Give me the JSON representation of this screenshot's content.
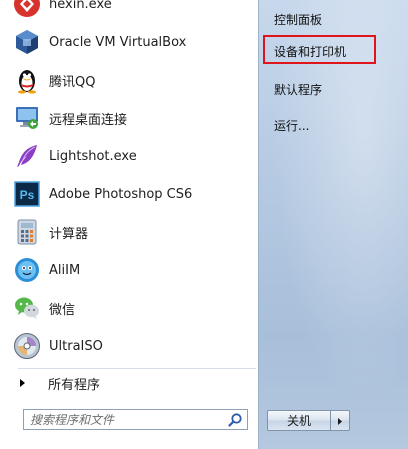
{
  "programs": [
    {
      "label": "hexin.exe",
      "icon": "hexin-icon"
    },
    {
      "label": "Oracle VM VirtualBox",
      "icon": "virtualbox-icon"
    },
    {
      "label": "腾讯QQ",
      "icon": "qq-penguin-icon"
    },
    {
      "label": "远程桌面连接",
      "icon": "remote-desktop-icon"
    },
    {
      "label": "Lightshot.exe",
      "icon": "lightshot-feather-icon"
    },
    {
      "label": "Adobe Photoshop CS6",
      "icon": "photoshop-icon"
    },
    {
      "label": "计算器",
      "icon": "calculator-icon"
    },
    {
      "label": "AliIM",
      "icon": "aliim-icon"
    },
    {
      "label": "微信",
      "icon": "wechat-icon"
    },
    {
      "label": "UltraISO",
      "icon": "ultraiso-disc-icon"
    }
  ],
  "all_programs": {
    "label": "所有程序"
  },
  "search": {
    "placeholder": "搜索程序和文件"
  },
  "right_menu": {
    "items": [
      {
        "label": "控制面板"
      },
      {
        "label": "设备和打印机"
      },
      {
        "label": "默认程序"
      },
      {
        "label": "运行..."
      }
    ]
  },
  "shutdown": {
    "label": "关机"
  },
  "colors": {
    "highlight_border": "#e0141b",
    "right_panel": "#b7cbe3",
    "left_panel": "#ffffff"
  }
}
